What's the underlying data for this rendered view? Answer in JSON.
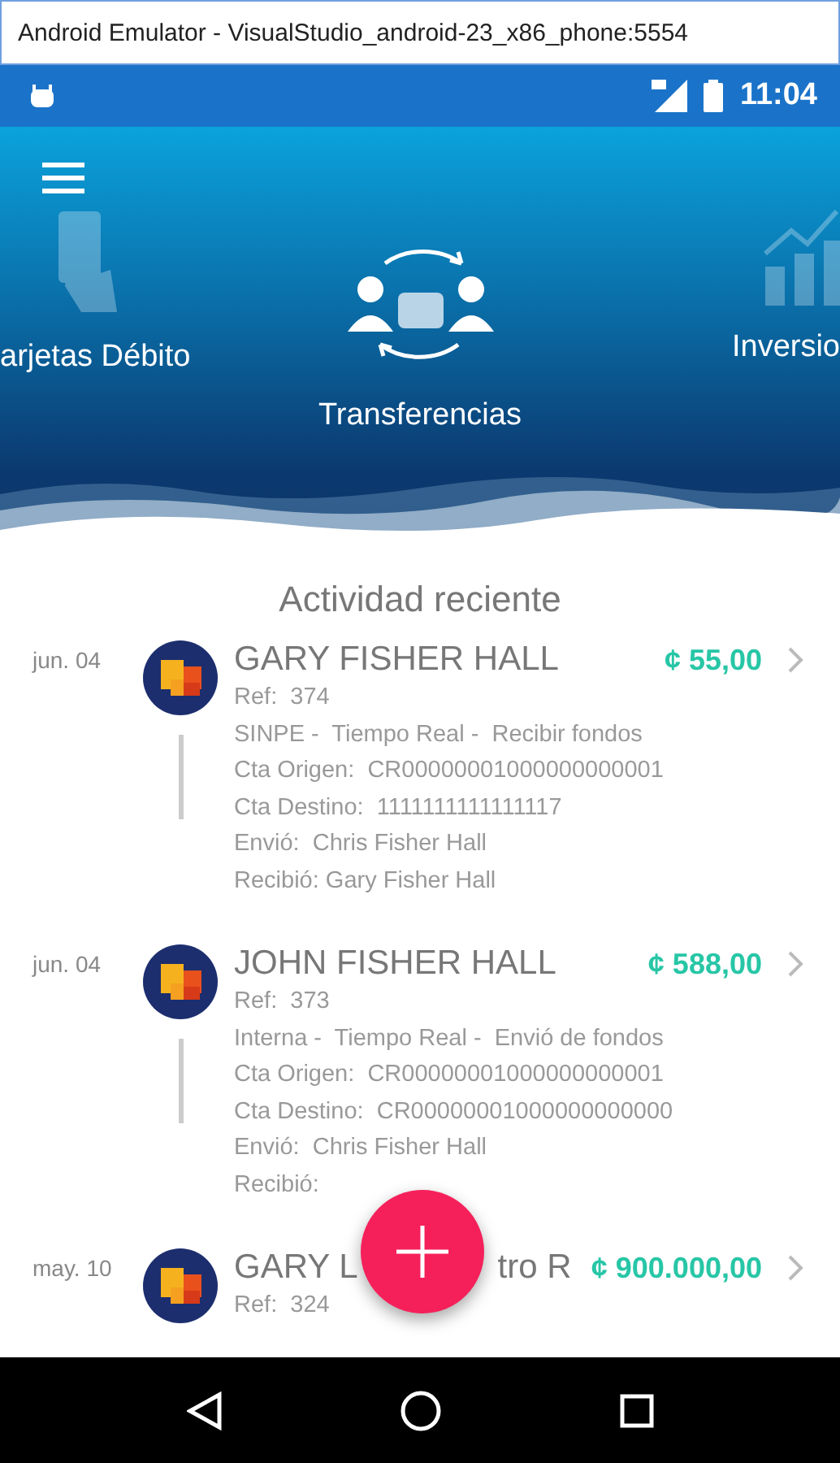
{
  "window": {
    "title": "Android Emulator - VisualStudio_android-23_x86_phone:5554"
  },
  "status_bar": {
    "time": "11:04"
  },
  "carousel": [
    {
      "label": "arjetas Débito",
      "kind": "card",
      "selected": false
    },
    {
      "label": "Transferencias",
      "kind": "transfer",
      "selected": true
    },
    {
      "label": "Inversio",
      "kind": "chart",
      "selected": false
    }
  ],
  "section_title": "Actividad reciente",
  "activity": [
    {
      "date": "jun. 04",
      "name": "GARY FISHER HALL",
      "amount": "¢ 55,00",
      "details": [
        "Ref:  374",
        "SINPE -  Tiempo Real -  Recibir fondos",
        "Cta Origen:  CR00000001000000000001",
        "Cta Destino:  1111111111111117",
        "Envió:  Chris Fisher Hall",
        "Recibió: Gary Fisher Hall"
      ]
    },
    {
      "date": "jun. 04",
      "name": "JOHN FISHER HALL",
      "amount": "¢ 588,00",
      "details": [
        "Ref:  373",
        "Interna -  Tiempo Real -  Envió de fondos",
        "Cta Origen:  CR00000001000000000001",
        "Cta Destino:  CR00000001000000000000",
        "Envió:  Chris Fisher Hall",
        "Recibió:"
      ]
    },
    {
      "date": "may. 10",
      "name": "GARY L",
      "name_tail": "tro R",
      "amount": "¢ 900.000,00",
      "details": [
        "Ref:  324"
      ]
    }
  ]
}
